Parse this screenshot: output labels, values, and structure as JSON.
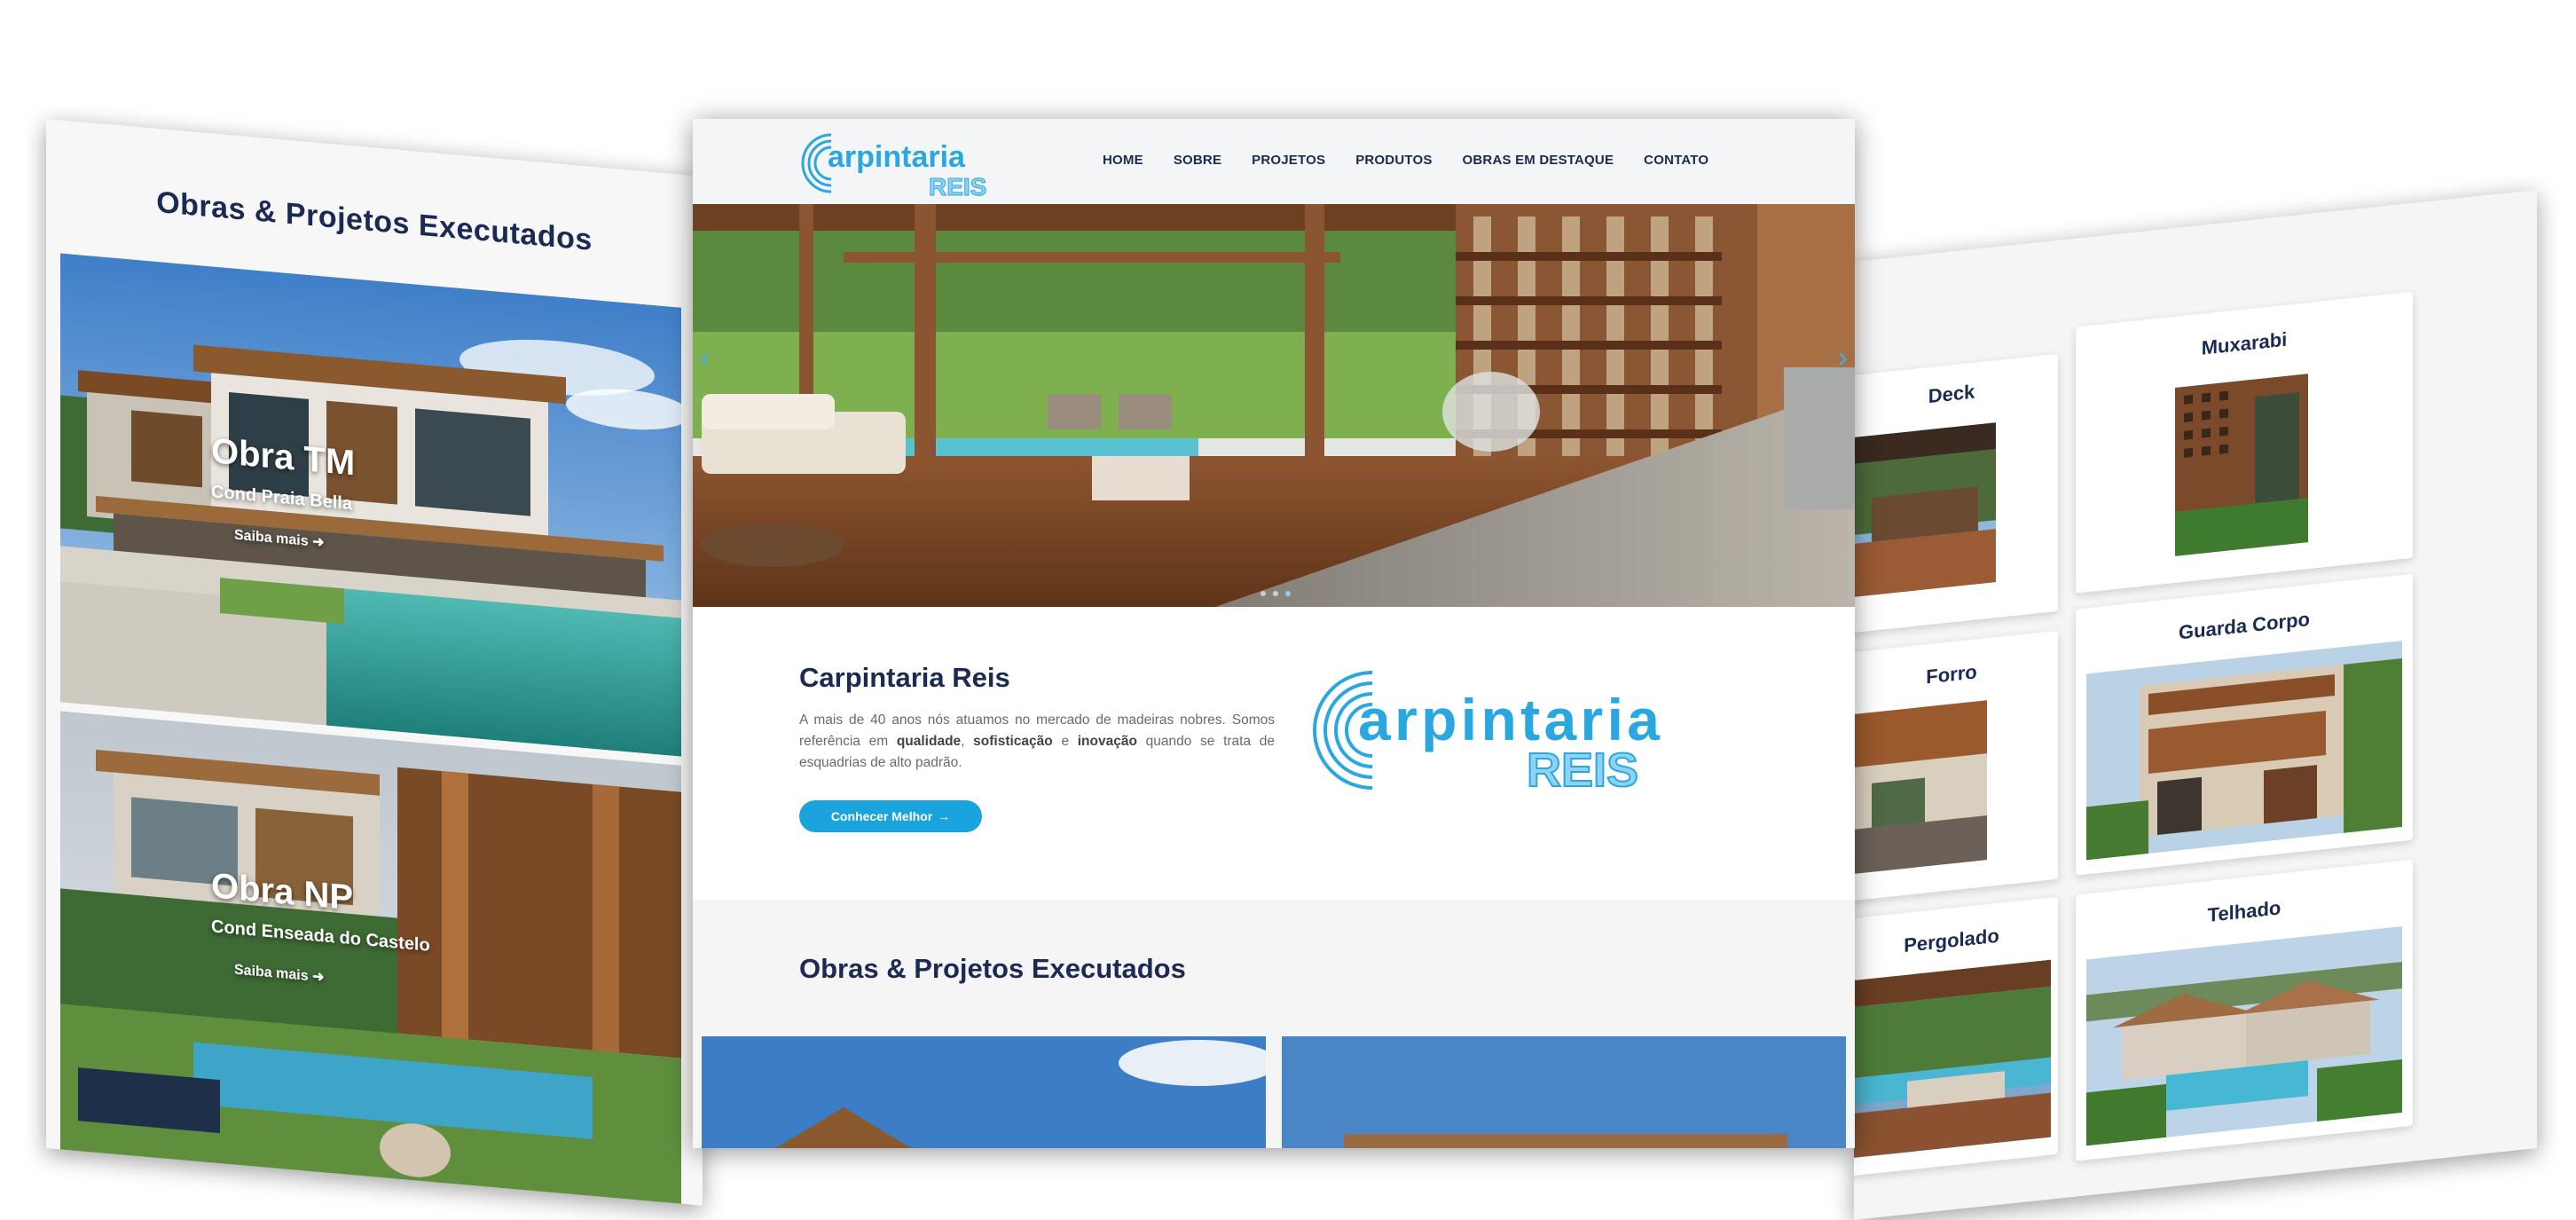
{
  "left": {
    "title": "Obras & Projetos Executados",
    "cards": [
      {
        "name": "Obra TM",
        "sub": "Cond Praia Bella",
        "link": "Saiba mais"
      },
      {
        "name": "Obra NP",
        "sub": "Cond Enseada do Castelo",
        "link": "Saiba mais"
      }
    ]
  },
  "center": {
    "logo_top": "arpintaria",
    "logo_bottom": "REIS",
    "nav": [
      "HOME",
      "SOBRE",
      "PROJETOS",
      "PRODUTOS",
      "OBRAS EM DESTAQUE",
      "CONTATO"
    ],
    "slider": {
      "prev": "‹",
      "next": "›",
      "slides": 3,
      "active": 3
    },
    "about": {
      "title": "Carpintaria Reis",
      "text_1": "A mais de 40 anos nós atuamos no mercado de madeiras nobres. Somos referência em ",
      "bold_1": "qualidade",
      "sep_1": ", ",
      "bold_2": "sofisticação",
      "sep_2": " e ",
      "bold_3": "inovação",
      "text_2": " quando se trata de esquadrias de alto padrão.",
      "button": "Conhecer Melhor",
      "button_icon": "→"
    },
    "projects_title": "Obras & Projetos Executados"
  },
  "right": {
    "products": [
      "Deck",
      "Muxarabi",
      "Forro",
      "Guarda Corpo",
      "Pergolado",
      "Telhado"
    ]
  },
  "colors": {
    "navy": "#1b2a55",
    "accent": "#1aa3dc",
    "logo_blue": "#2aa7e0",
    "logo_light": "#8fd3f4"
  }
}
